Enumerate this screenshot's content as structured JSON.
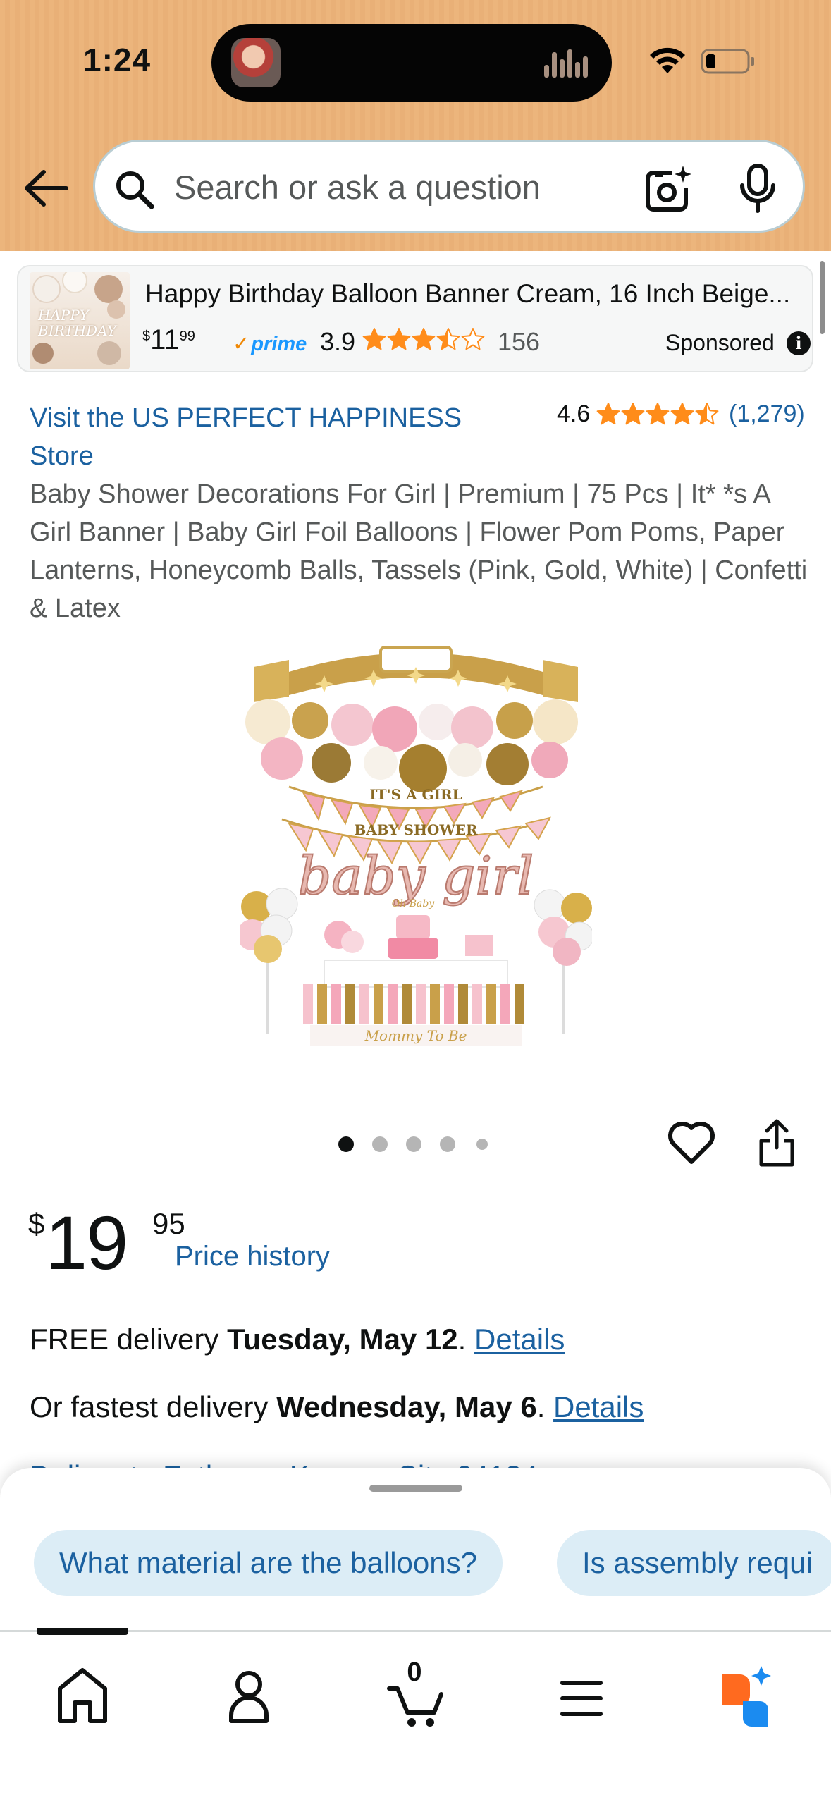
{
  "status_bar": {
    "time": "1:24"
  },
  "search": {
    "placeholder": "Search or ask a question"
  },
  "sponsored_ad": {
    "thumb_text": "HAPPY BIRTHDAY",
    "title": "Happy Birthday Balloon Banner Cream, 16 Inch Beige...",
    "price_symbol": "$",
    "price_whole": "11",
    "price_fraction": "99",
    "prime_label": "prime",
    "rating": "3.9",
    "rating_value": 3.5,
    "review_count": "156",
    "sponsored_label": "Sponsored"
  },
  "product": {
    "store_link": "Visit the US PERFECT HAPPINESS Store",
    "rating": "4.6",
    "rating_value": 4.5,
    "rating_count": "(1,279)",
    "title": "Baby Shower Decorations For Girl | Premium | 75 Pcs | It* *s A Girl Banner | Baby Girl Foil Balloons | Flower Pom Poms, Paper Lanterns, Honeycomb Balls, Tassels (Pink, Gold, White) | Confetti & Latex",
    "image_texts": {
      "banner1": "IT'S A GIRL",
      "banner2": "BABY SHOWER",
      "balloon_script": "baby girl",
      "topper": "Oh Baby",
      "sash": "Mommy To Be"
    },
    "image_count": 5,
    "active_image_index": 0,
    "price": {
      "currency": "$",
      "whole": "19",
      "fraction": "95"
    },
    "price_history_label": "Price history"
  },
  "delivery": {
    "free_prefix": "FREE delivery ",
    "free_date": "Tuesday, May 12",
    "free_sep": ". ",
    "free_details": "Details",
    "fast_prefix": "Or fastest delivery ",
    "fast_date": "Wednesday, May 6",
    "fast_sep": ". ",
    "fast_details": "Details",
    "location_partial": "Deliver to Fathom - Kansas City 64124"
  },
  "ask_sheet": {
    "chips": [
      "What material are the balloons?",
      "Is assembly requi"
    ]
  },
  "tabbar": {
    "items": [
      "home-icon",
      "account-icon",
      "cart-icon",
      "menu-icon",
      "rufus-icon"
    ],
    "cart_count": "0",
    "active_index": 0
  },
  "colors": {
    "header_bg": "#ecb57c",
    "link_blue": "#1b61a0",
    "star_orange": "#ff8c1a",
    "chip_bg": "#dcedf6",
    "prime_blue": "#1a98ff"
  }
}
